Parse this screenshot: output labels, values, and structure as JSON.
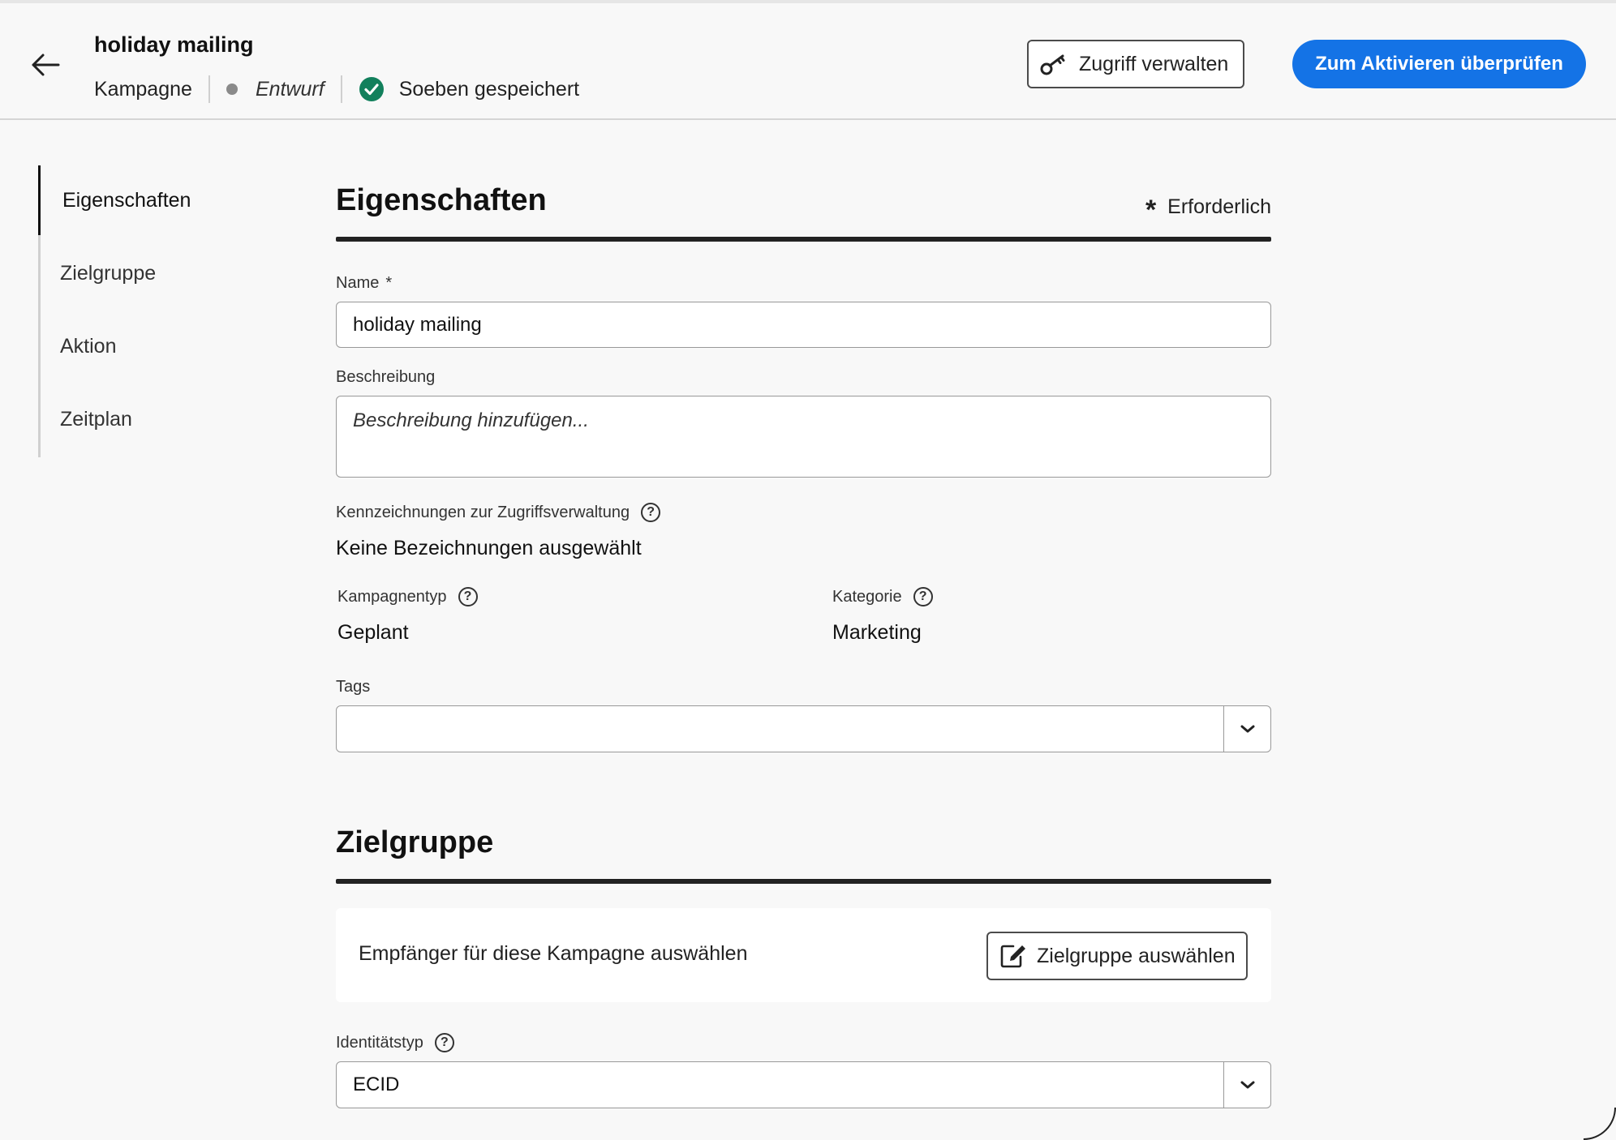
{
  "header": {
    "title": "holiday mailing",
    "type": "Kampagne",
    "status": "Entwurf",
    "save_state": "Soeben gespeichert",
    "access_button": "Zugriff verwalten",
    "primary_button": "Zum Aktivieren überprüfen"
  },
  "sidebar": {
    "items": [
      {
        "label": "Eigenschaften",
        "active": true
      },
      {
        "label": "Zielgruppe",
        "active": false
      },
      {
        "label": "Aktion",
        "active": false
      },
      {
        "label": "Zeitplan",
        "active": false
      }
    ]
  },
  "properties": {
    "title": "Eigenschaften",
    "required_label": "Erforderlich",
    "name_label": "Name",
    "name_value": "holiday mailing",
    "description_label": "Beschreibung",
    "description_placeholder": "Beschreibung hinzufügen...",
    "access_labels_label": "Kennzeichnungen zur Zugriffsverwaltung",
    "access_labels_value": "Keine Bezeichnungen ausgewählt",
    "campaign_type_label": "Kampagnentyp",
    "campaign_type_value": "Geplant",
    "category_label": "Kategorie",
    "category_value": "Marketing",
    "tags_label": "Tags",
    "tags_value": ""
  },
  "audience": {
    "title": "Zielgruppe",
    "card_text": "Empfänger für diese Kampagne auswählen",
    "select_button": "Zielgruppe auswählen",
    "identity_label": "Identitätstyp",
    "identity_value": "ECID"
  },
  "colors": {
    "primary": "#1473e6",
    "saved_check": "#12805c",
    "background": "#f8f8f8"
  }
}
